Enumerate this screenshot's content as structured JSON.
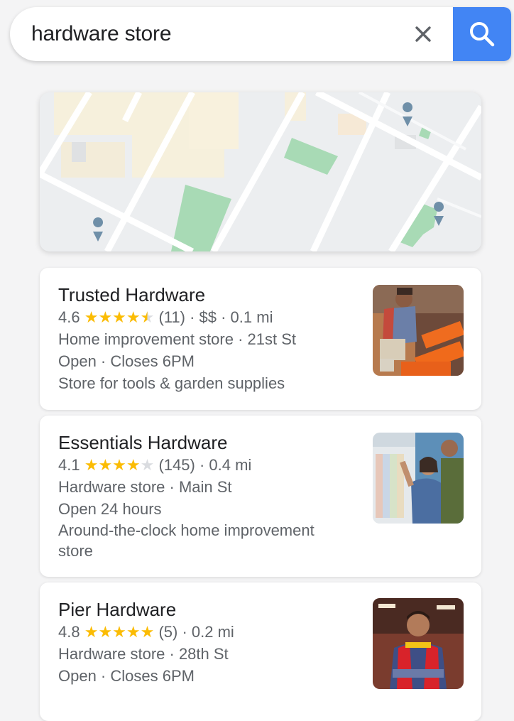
{
  "search": {
    "query": "hardware store"
  },
  "results": [
    {
      "name": "Trusted Hardware",
      "rating": "4.6",
      "stars": 4.5,
      "reviews": "(11)",
      "meta": " · $$ · 0.1 mi",
      "category_line": "Home improvement store · 21st St",
      "hours_line": "Open · Closes 6PM",
      "description": "Store for tools & garden supplies"
    },
    {
      "name": "Essentials Hardware",
      "rating": "4.1",
      "stars": 4,
      "reviews": "(145)",
      "meta": " · 0.4 mi",
      "category_line": "Hardware store · Main St",
      "hours_line": "Open 24 hours",
      "description": "Around-the-clock home improvement store"
    },
    {
      "name": "Pier Hardware",
      "rating": "4.8",
      "stars": 5,
      "reviews": "(5)",
      "meta": " · 0.2 mi",
      "category_line": "Hardware store · 28th St",
      "hours_line": "Open · Closes 6PM"
    }
  ],
  "colors": {
    "accent": "#4285f4",
    "star": "#fbbc04",
    "park": "#a8dab5"
  }
}
